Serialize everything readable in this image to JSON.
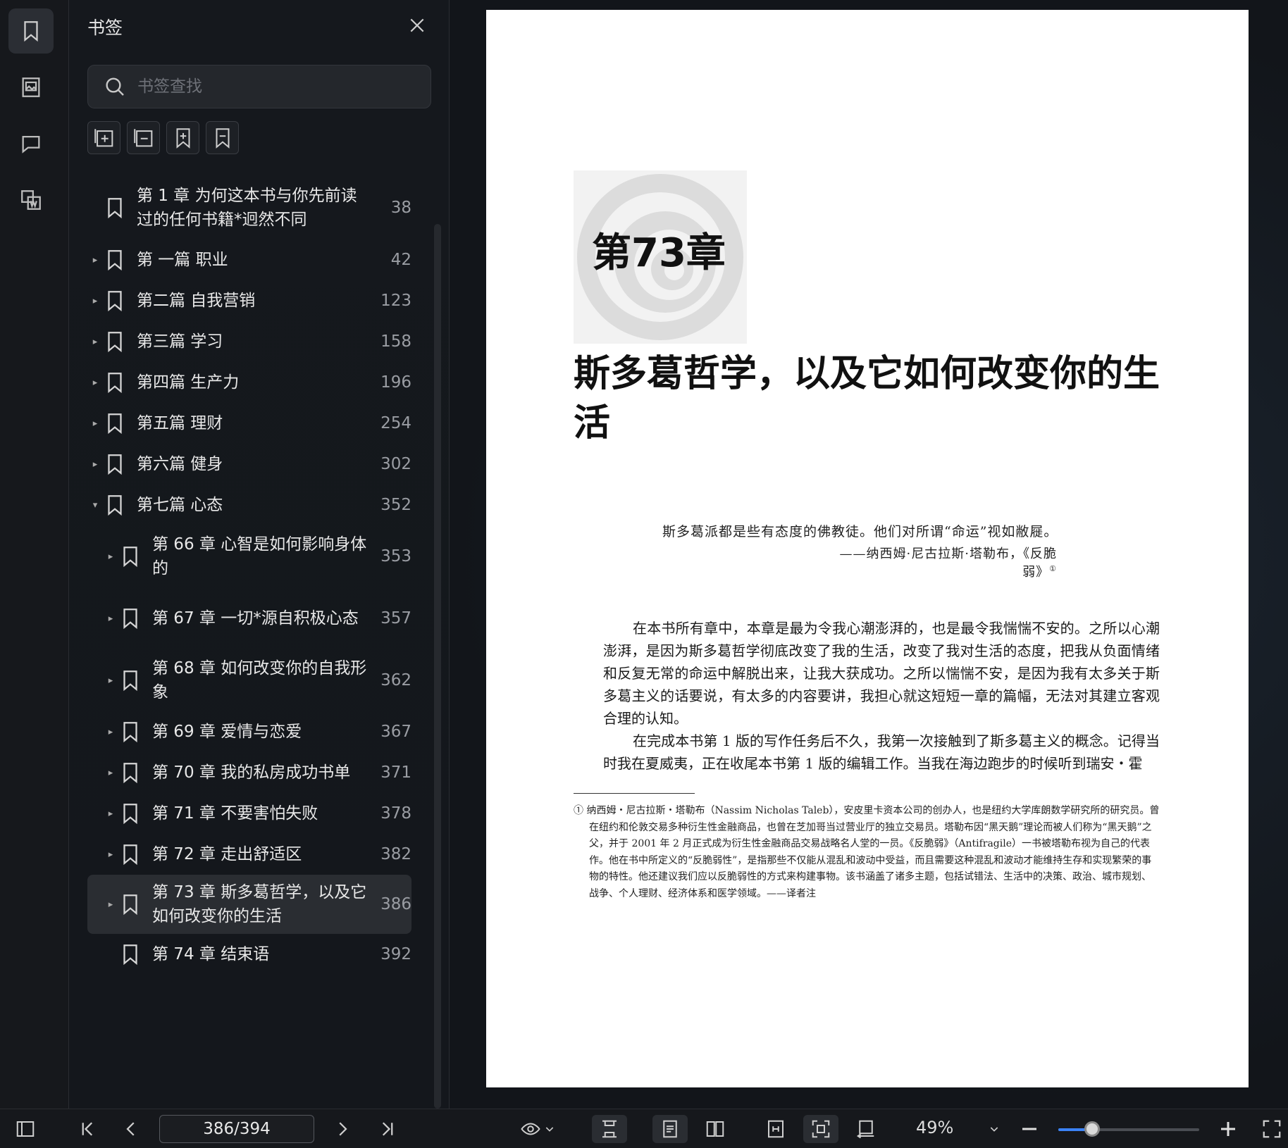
{
  "panel": {
    "title": "书签",
    "search_placeholder": "书签查找"
  },
  "bookmarks": [
    {
      "label": "第 1 章 为何这本书与你先前读过的任何书籍*迥然不同",
      "page": "38",
      "level": 0,
      "arrow": ""
    },
    {
      "label": "第 一篇 职业",
      "page": "42",
      "level": 0,
      "arrow": "▸"
    },
    {
      "label": "第二篇 自我营销",
      "page": "123",
      "level": 0,
      "arrow": "▸"
    },
    {
      "label": "第三篇 学习",
      "page": "158",
      "level": 0,
      "arrow": "▸"
    },
    {
      "label": "第四篇 生产力",
      "page": "196",
      "level": 0,
      "arrow": "▸"
    },
    {
      "label": "第五篇 理财",
      "page": "254",
      "level": 0,
      "arrow": "▸"
    },
    {
      "label": "第六篇 健身",
      "page": "302",
      "level": 0,
      "arrow": "▸"
    },
    {
      "label": "第七篇 心态",
      "page": "352",
      "level": 0,
      "arrow": "▾"
    },
    {
      "label": "第 66 章 心智是如何影响身体的",
      "page": "353",
      "level": 1,
      "arrow": "▸"
    },
    {
      "label": "第 67 章 一切*源自积极心态",
      "page": "357",
      "level": 1,
      "arrow": "▸"
    },
    {
      "label": "第 68 章 如何改变你的自我形象",
      "page": "362",
      "level": 1,
      "arrow": "▸"
    },
    {
      "label": "第 69 章 爱情与恋爱",
      "page": "367",
      "level": 1,
      "arrow": "▸"
    },
    {
      "label": "第 70 章 我的私房成功书单",
      "page": "371",
      "level": 1,
      "arrow": "▸"
    },
    {
      "label": "第 71 章 不要害怕失败",
      "page": "378",
      "level": 1,
      "arrow": "▸"
    },
    {
      "label": "第 72 章 走出舒适区",
      "page": "382",
      "level": 1,
      "arrow": "▸"
    },
    {
      "label": "第 73 章 斯多葛哲学，以及它如何改变你的生活",
      "page": "386",
      "level": 1,
      "arrow": "▸",
      "selected": true
    },
    {
      "label": "第 74 章 结束语",
      "page": "392",
      "level": 1,
      "arrow": ""
    }
  ],
  "doc": {
    "chapter_number": "第73章",
    "chapter_title": "斯多葛哲学，以及它如何改变你的生活",
    "epigraph": "斯多葛派都是些有态度的佛教徒。他们对所谓“命运”视如敝屣。",
    "epigraph_source": "——纳西姆·尼古拉斯·塔勒布，《反脆弱》",
    "epigraph_note": "①",
    "paragraphs": [
      "在本书所有章中，本章是最为令我心潮澎湃的，也是最令我惴惴不安的。之所以心潮澎湃，是因为斯多葛哲学彻底改变了我的生活，改变了我对生活的态度，把我从负面情绪和反复无常的命运中解脱出来，让我大获成功。之所以惴惴不安，是因为我有太多关于斯多葛主义的话要说，有太多的内容要讲，我担心就这短短一章的篇幅，无法对其建立客观合理的认知。",
      "在完成本书第 1 版的写作任务后不久，我第一次接触到了斯多葛主义的概念。记得当时我在夏威夷，正在收尾本书第 1 版的编辑工作。当我在海边跑步的时候听到瑞安・霍"
    ],
    "footnote": "① 纳西姆・尼古拉斯・塔勒布（Nassim Nicholas Taleb），安皮里卡资本公司的创办人，也是纽约大学库朗数学研究所的研究员。曾在纽约和伦敦交易多种衍生性金融商品，也曾在芝加哥当过营业厅的独立交易员。塔勒布因“黑天鹅”理论而被人们称为“黑天鹅”之父，并于 2001 年 2 月正式成为衍生性金融商品交易战略名人堂的一员。《反脆弱》（Antifragile）一书被塔勒布视为自己的代表作。他在书中所定义的“反脆弱性”，是指那些不仅能从混乱和波动中受益，而且需要这种混乱和波动才能维持生存和实现繁荣的事物的特性。他还建议我们应以反脆弱性的方式来构建事物。该书涵盖了诸多主题，包括试错法、生活中的决策、政治、城市规划、战争、个人理财、经济体系和医学领域。——译者注"
  },
  "toolbar": {
    "page_indicator": "386/394",
    "zoom_label": "49%",
    "zoom_fraction": 0.24
  },
  "colors": {
    "accent": "#3b82f6",
    "panel_bg": "#15181d",
    "selected_bg": "#2a2d32"
  }
}
